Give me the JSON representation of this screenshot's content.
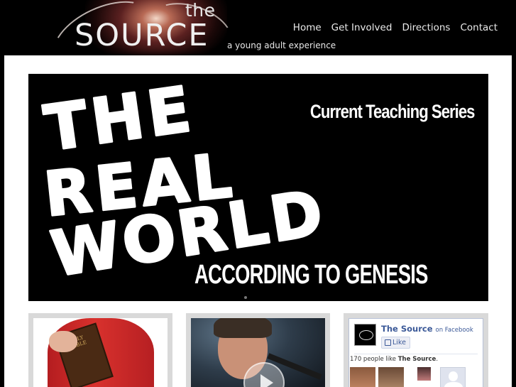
{
  "header": {
    "logo_the": "the",
    "logo_source": "SOURCE",
    "tagline": "a young adult experience",
    "nav": [
      "Home",
      "Get Involved",
      "Directions",
      "Contact"
    ]
  },
  "slider": {
    "series_label": "Current Teaching Series",
    "title_lines": [
      "THE",
      "REAL",
      "WORLD"
    ],
    "subtitle": "ACCORDING TO GENESIS"
  },
  "boxes": {
    "bible_text": "HOLY BIBLE"
  },
  "facebook": {
    "page_name": "The Source",
    "on_facebook": "on Facebook",
    "like_label": "Like",
    "count_prefix": "170 people like",
    "count_name": "The Source",
    "count_suffix": "."
  },
  "colors": {
    "facebook_blue": "#3b5998",
    "background": "#000000",
    "content_bg": "#ffffff",
    "box_frame": "#d9d9d9"
  }
}
